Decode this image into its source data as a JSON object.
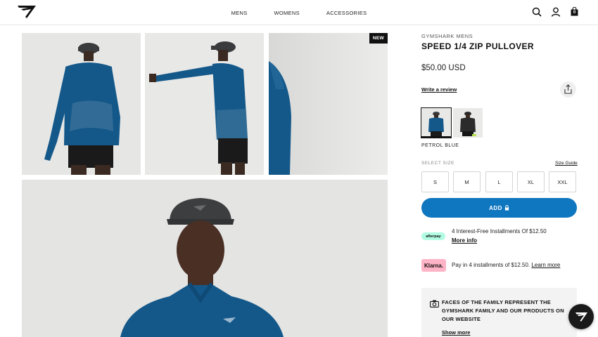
{
  "header": {
    "logo_icon": "gymshark-logo-icon",
    "nav": [
      "MENS",
      "WOMENS",
      "ACCESSORIES"
    ],
    "icons": [
      "search-icon",
      "account-icon",
      "bag-icon"
    ],
    "bag_count": "0"
  },
  "gallery": {
    "badge": "NEW",
    "images": [
      "back-view-photo",
      "side-stretch-photo",
      "sleeve-closeup-photo",
      "front-portrait-photo"
    ]
  },
  "product": {
    "brand": "GYMSHARK MENS",
    "title": "SPEED 1/4 ZIP PULLOVER",
    "price": "$50.00 USD",
    "review_label": "Write a review",
    "color_name": "PETROL BLUE",
    "select_size_label": "SELECT SIZE",
    "size_guide_label": "Size Guide",
    "sizes": [
      "S",
      "M",
      "L",
      "XL",
      "XXL"
    ],
    "add_label": "ADD",
    "colors": {
      "accent": "#0f76c0",
      "afterpay": "#b2fce4",
      "klarna": "#ffb3c7"
    }
  },
  "afterpay": {
    "logo": "afterpay",
    "text": "4 Interest-Free Installments Of $12.50",
    "more": "More info"
  },
  "klarna": {
    "logo": "Klarna.",
    "text": "Pay in 4 installments of $12.50.",
    "more": "Learn more"
  },
  "faces": {
    "text": "FACES OF THE FAMILY REPRESENT THE GYMSHARK FAMILY AND OUR PRODUCTS ON OUR WEBSITE",
    "more": "Show more"
  }
}
